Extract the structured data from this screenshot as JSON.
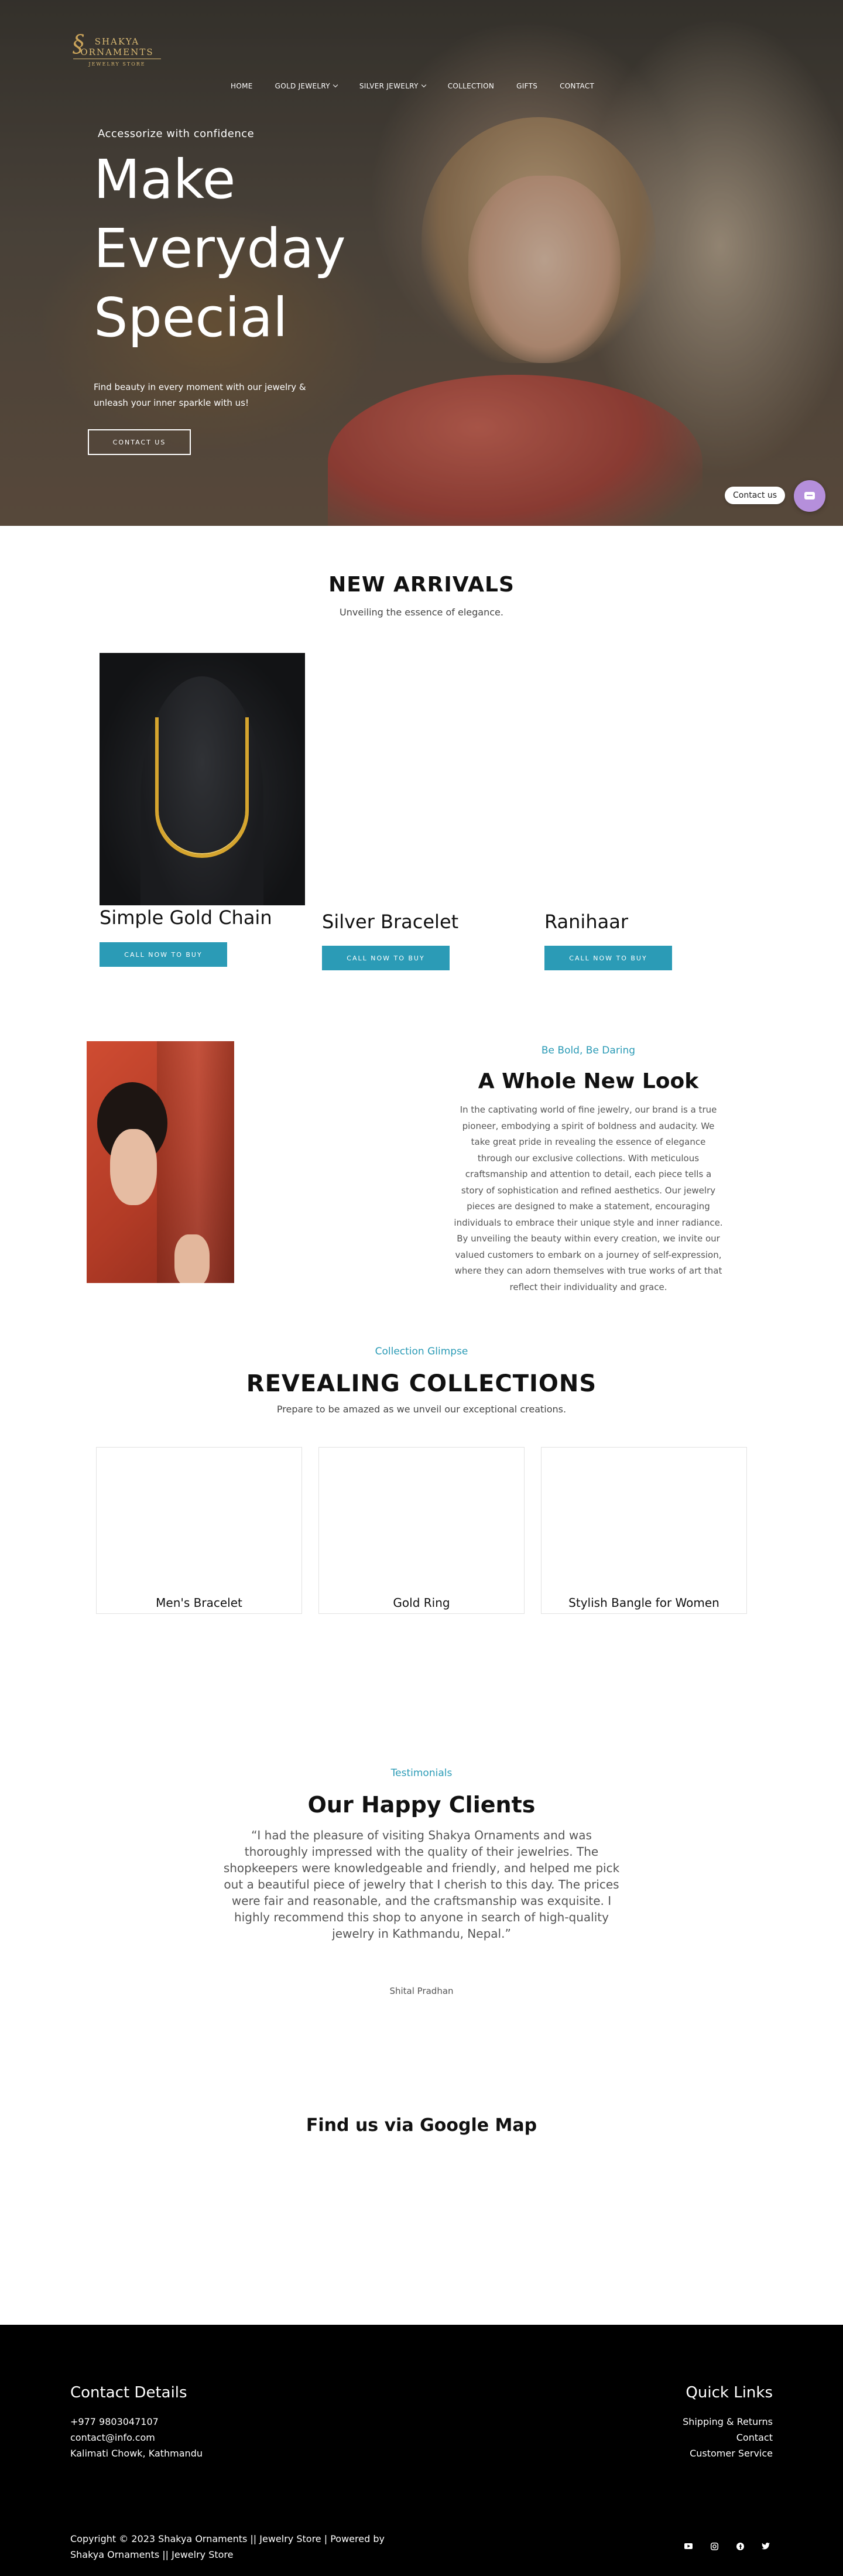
{
  "brand": {
    "line1": "SHAKYA",
    "line2": "ORNAMENTS",
    "line3": "JEWELRY STORE"
  },
  "nav": {
    "items": [
      {
        "label": "HOME"
      },
      {
        "label": "GOLD JEWELRY"
      },
      {
        "label": "SILVER JEWELRY"
      },
      {
        "label": "COLLECTION"
      },
      {
        "label": "GIFTS"
      },
      {
        "label": "CONTACT"
      }
    ]
  },
  "hero": {
    "kicker": "Accessorize with confidence",
    "title_line1": "Make",
    "title_line2": "Everyday",
    "title_line3": "Special",
    "subtitle": "Find beauty in every moment with our jewelry & unleash your inner sparkle with us!",
    "button": "CONTACT US"
  },
  "contact_widget": {
    "label": "Contact us"
  },
  "new_arrivals": {
    "title": "NEW ARRIVALS",
    "subtitle": "Unveiling the essence of elegance.",
    "products": [
      {
        "name": "Simple Gold Chain",
        "button": "CALL NOW TO BUY"
      },
      {
        "name": "Silver Bracelet",
        "button": "CALL NOW TO BUY"
      },
      {
        "name": "Ranihaar",
        "button": "CALL NOW TO BUY"
      }
    ]
  },
  "new_look": {
    "kicker": "Be Bold, Be Daring",
    "title": "A Whole New Look",
    "body": "In the captivating world of fine jewelry, our brand is a true pioneer, embodying a spirit of boldness and audacity. We take great pride in revealing the essence of elegance through our exclusive collections. With meticulous craftsmanship and attention to detail, each piece tells a story of sophistication and refined aesthetics. Our jewelry pieces are designed to make a statement, encouraging individuals to embrace their unique style and inner radiance. By unveiling the beauty within every creation, we invite our valued customers to embark on a journey of self-expression, where they can adorn themselves with true works of art that reflect their individuality and grace."
  },
  "collections": {
    "kicker": "Collection Glimpse",
    "title": "REVEALING COLLECTIONS",
    "subtitle": "Prepare to be amazed as we unveil our exceptional creations.",
    "items": [
      {
        "label": "Men's Bracelet"
      },
      {
        "label": "Gold Ring"
      },
      {
        "label": "Stylish Bangle for Women"
      }
    ]
  },
  "testimonials": {
    "kicker": "Testimonials",
    "title": "Our Happy Clients",
    "quote": "“I had the pleasure of visiting Shakya Ornaments and was thoroughly impressed with the quality of their jewelries. The shopkeepers were knowledgeable and friendly, and helped me pick out a beautiful piece of jewelry that I cherish to this day. The prices were fair and reasonable, and the craftsmanship was exquisite. I highly recommend this shop to anyone in search of high-quality jewelry in Kathmandu, Nepal.”",
    "author": "Shital Pradhan"
  },
  "map": {
    "title": "Find us via Google Map"
  },
  "footer": {
    "contact_title": "Contact Details",
    "phone": "+977 9803047107",
    "email": "contact@info.com",
    "address": "Kalimati Chowk, Kathmandu",
    "links_title": "Quick Links",
    "links": [
      "Shipping & Returns",
      "Contact",
      "Customer Service"
    ],
    "copyright": "Copyright © 2023 Shakya Ornaments || Jewelry Store | Powered by Shakya Ornaments || Jewelry Store",
    "social": [
      "youtube-icon",
      "instagram-icon",
      "facebook-icon",
      "twitter-icon"
    ]
  },
  "colors": {
    "accent": "#2b9bb6",
    "footer_bg": "#000000",
    "widget": "#b58fdb",
    "logo_gold": "#d8b873"
  }
}
